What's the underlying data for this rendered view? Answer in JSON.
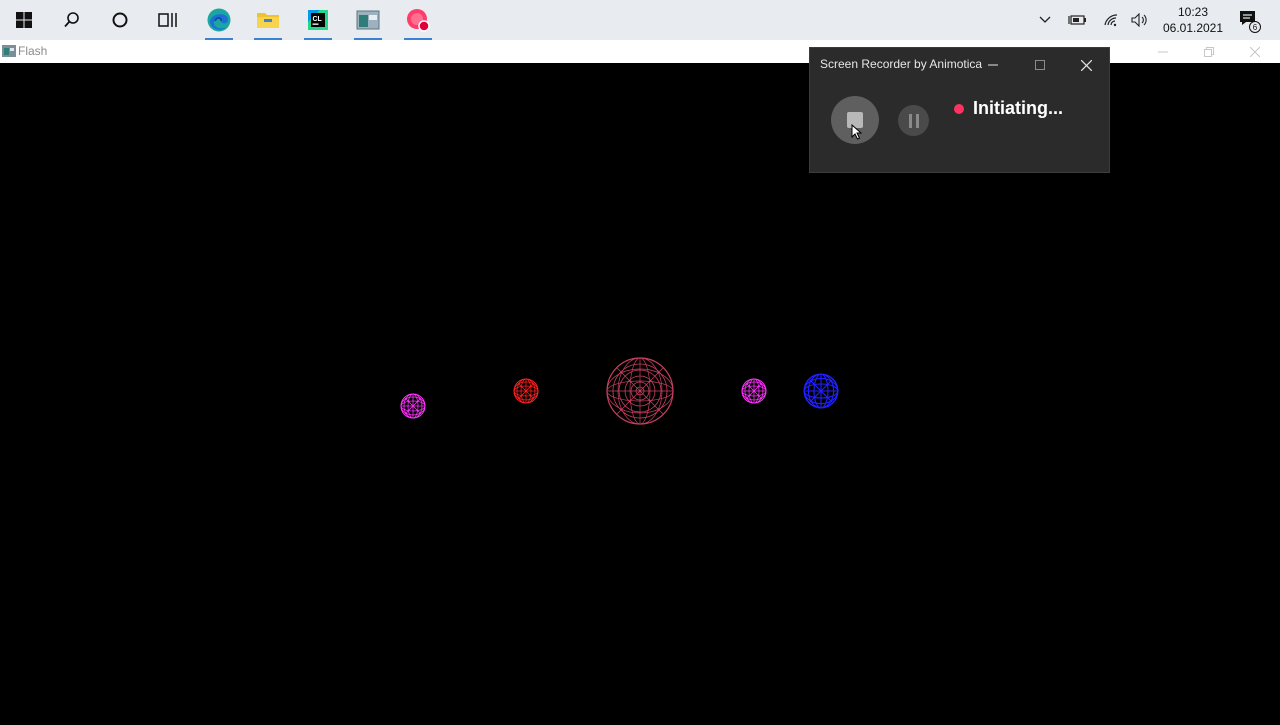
{
  "taskbar": {
    "start_icon": "windows-logo-icon",
    "search_icon": "search-icon",
    "cortana_icon": "cortana-icon",
    "taskview_icon": "task-view-icon",
    "pinned_apps": [
      {
        "name": "Microsoft Edge",
        "icon": "edge-icon"
      },
      {
        "name": "File Explorer",
        "icon": "folder-icon"
      },
      {
        "name": "CLion",
        "icon": "clion-icon",
        "label": "CL"
      },
      {
        "name": "App",
        "icon": "app-window-icon"
      },
      {
        "name": "Screen Recorder",
        "icon": "screen-recorder-icon"
      }
    ],
    "tray": {
      "clock_time": "10:23",
      "clock_date": "06.01.2021",
      "notification_count": "6"
    }
  },
  "flash_window": {
    "title": "Flash"
  },
  "recorder": {
    "title": "Screen Recorder by Animotica",
    "status": "Initiating...",
    "status_color": "#ff3360"
  },
  "scene": {
    "description_colors": [
      "#ff33ff",
      "#ff2020",
      "#c84060",
      "#ff33ff",
      "#2020ff"
    ]
  }
}
